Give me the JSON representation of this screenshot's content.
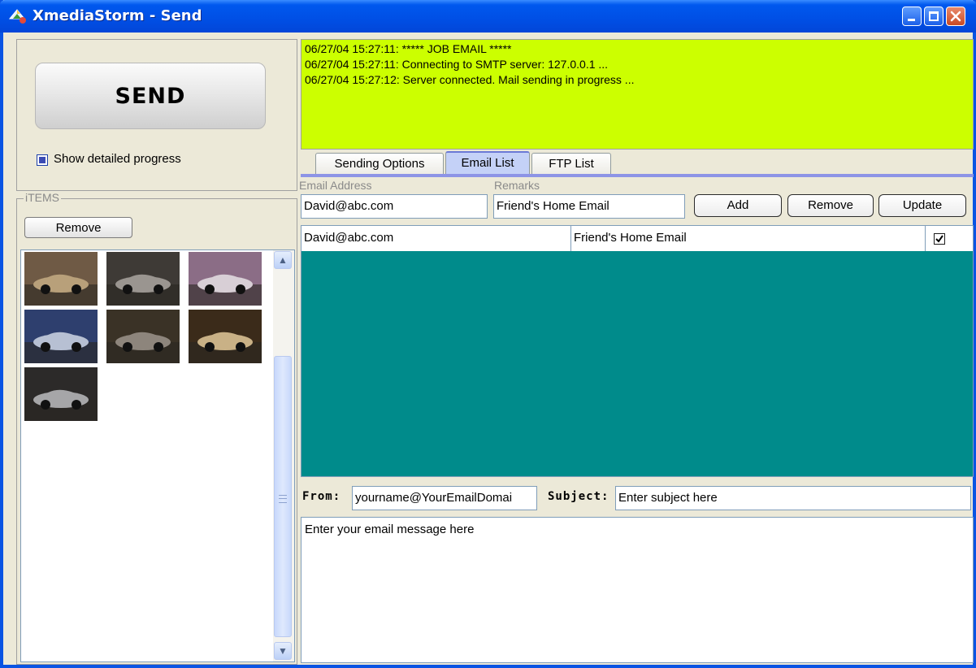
{
  "window": {
    "title": "XmediaStorm - Send",
    "title_bar_color": "#0054e3"
  },
  "send_panel": {
    "send_label": "SEND",
    "show_progress_label": "Show detailed progress",
    "show_progress_checked": true
  },
  "items_panel": {
    "legend": "iTEMS",
    "remove_label": "Remove",
    "thumbnails": [
      {
        "icon": "car-thumbnail-1",
        "palette": [
          "#6f5a45",
          "#b8a07a"
        ]
      },
      {
        "icon": "car-thumbnail-2",
        "palette": [
          "#3e3a36",
          "#9a9590"
        ]
      },
      {
        "icon": "car-thumbnail-3",
        "palette": [
          "#8b6d86",
          "#d8cfd6"
        ]
      },
      {
        "icon": "car-thumbnail-4",
        "palette": [
          "#2e3f6e",
          "#b7c0d3"
        ]
      },
      {
        "icon": "car-thumbnail-5",
        "palette": [
          "#3a3226",
          "#8d857c"
        ]
      },
      {
        "icon": "car-thumbnail-6",
        "palette": [
          "#3b2b1a",
          "#c9b186"
        ]
      },
      {
        "icon": "car-thumbnail-7",
        "palette": [
          "#2c2a29",
          "#a6a6a8"
        ]
      }
    ]
  },
  "log": {
    "background": "#ccff00",
    "lines": [
      "06/27/04 15:27:11: ***** JOB EMAIL *****",
      "06/27/04 15:27:11: Connecting to SMTP server: 127.0.0.1 ...",
      "06/27/04 15:27:12: Server connected. Mail sending in progress ..."
    ]
  },
  "tabs": [
    {
      "label": "Sending Options",
      "active": false
    },
    {
      "label": "Email List",
      "active": true
    },
    {
      "label": "FTP List",
      "active": false
    }
  ],
  "email_form": {
    "address_label": "Email Address",
    "remarks_label": "Remarks",
    "address_value": "David@abc.com",
    "remarks_value": "Friend's Home Email",
    "add_label": "Add",
    "remove_label": "Remove",
    "update_label": "Update"
  },
  "email_list": {
    "background": "#008b8b",
    "rows": [
      {
        "address": "David@abc.com",
        "remarks": "Friend's Home Email",
        "checked": true
      }
    ]
  },
  "compose": {
    "from_label": "From:",
    "from_value": "yourname@YourEmailDomai",
    "subject_label": "Subject:",
    "subject_placeholder": "Enter subject here",
    "message_placeholder": "Enter your email message here"
  }
}
